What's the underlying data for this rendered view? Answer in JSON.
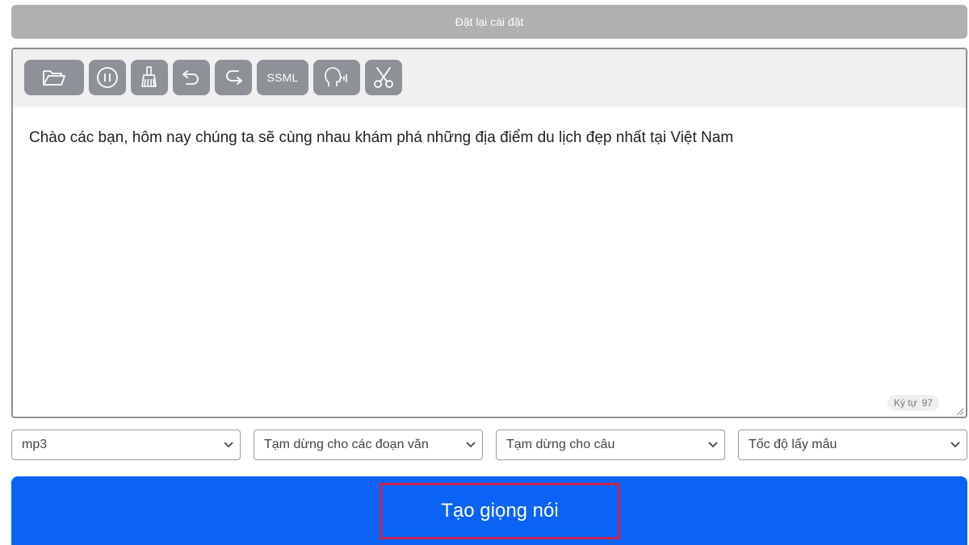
{
  "reset": {
    "label": "Đặt lại cài đặt"
  },
  "toolbar": {
    "ssml_label": "SSML",
    "icons": {
      "open": "folder-open-icon",
      "pause": "pause-icon",
      "clean": "broom-icon",
      "undo": "undo-icon",
      "redo": "redo-icon",
      "voice": "speaking-head-icon",
      "cut": "scissors-icon"
    }
  },
  "editor": {
    "text": "Chào các bạn, hôm nay chúng ta sẽ cùng nhau khám phá những địa điểm du lịch đẹp nhất tại Việt Nam",
    "char_count_label": "Ký tự",
    "char_count": "97"
  },
  "selects": {
    "format": "mp3",
    "paragraph_pause": "Tạm dừng cho các đoạn văn",
    "sentence_pause": "Tạm dừng cho câu",
    "sample_rate": "Tốc độ lấy mẫu"
  },
  "create": {
    "label": "Tạo giọng nói"
  },
  "colors": {
    "primary": "#0a63f5",
    "tool_bg": "#8e9197",
    "highlight": "#c7264f",
    "reset_bg": "#b0b0b0"
  }
}
